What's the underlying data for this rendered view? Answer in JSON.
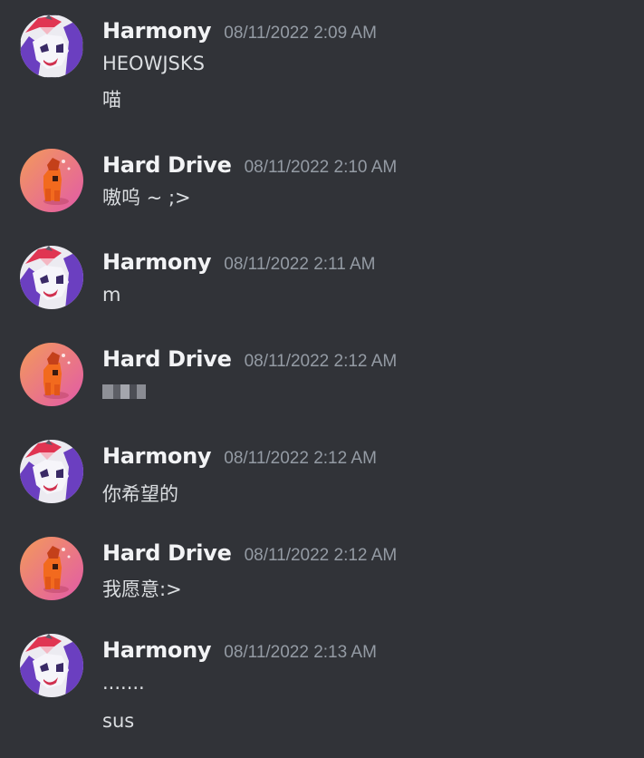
{
  "messages": [
    {
      "author": "Harmony",
      "timestamp": "08/11/2022 2:09 AM",
      "avatar_icon": "harmony-pony-avatar-icon",
      "lines": [
        "HEOWJSKS",
        "喵"
      ]
    },
    {
      "author": "Hard Drive",
      "timestamp": "08/11/2022 2:10 AM",
      "avatar_icon": "hard-drive-pony-avatar-icon",
      "lines": [
        "嗷呜 ~ ;>"
      ]
    },
    {
      "author": "Harmony",
      "timestamp": "08/11/2022 2:11 AM",
      "avatar_icon": "harmony-pony-avatar-icon",
      "lines": [
        "m"
      ]
    },
    {
      "author": "Hard Drive",
      "timestamp": "08/11/2022 2:12 AM",
      "avatar_icon": "hard-drive-pony-avatar-icon",
      "lines": [],
      "pixelated_content": true
    },
    {
      "author": "Harmony",
      "timestamp": "08/11/2022 2:12 AM",
      "avatar_icon": "harmony-pony-avatar-icon",
      "lines": [
        "你希望的"
      ]
    },
    {
      "author": "Hard Drive",
      "timestamp": "08/11/2022 2:12 AM",
      "avatar_icon": "hard-drive-pony-avatar-icon",
      "lines": [
        "我愿意:>"
      ]
    },
    {
      "author": "Harmony",
      "timestamp": "08/11/2022 2:13 AM",
      "avatar_icon": "harmony-pony-avatar-icon",
      "lines": [
        ".......",
        "sus"
      ]
    }
  ],
  "colors": {
    "background": "#313338",
    "username": "#f2f3f5",
    "timestamp": "#949ba4",
    "message_text": "#dbdee1"
  }
}
